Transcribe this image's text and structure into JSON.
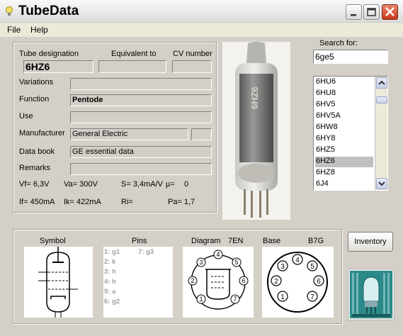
{
  "window": {
    "title": "TubeData"
  },
  "menu": [
    {
      "label": "File"
    },
    {
      "label": "Help"
    }
  ],
  "header": {
    "tube_designation_label": "Tube designation",
    "equivalent_label": "Equivalent to",
    "cv_label": "CV number",
    "tube_designation_value": "6HZ6",
    "equivalent_value": "",
    "cv_value": ""
  },
  "fields": {
    "variations_label": "Variations",
    "variations_value": "",
    "function_label": "Function",
    "function_value": "Pentode",
    "use_label": "Use",
    "use_value": "",
    "manufacturer_label": "Manufacturer",
    "manufacturer_value": "General Electric",
    "manufacturer_extra": "",
    "databook_label": "Data book",
    "databook_value": "GE essential data",
    "remarks_label": "Remarks",
    "remarks_value": ""
  },
  "params": {
    "vf": "Vf= 6,3V",
    "va": "Va= 300V",
    "s": "S= 3,4mA/V",
    "mu": "µ=",
    "mu_value": "0",
    "if": "If= 450mA",
    "ik": "Ik= 422mA",
    "ri": "Ri=",
    "pa": "Pa= 1,7"
  },
  "search": {
    "label": "Search for:",
    "value": "6ge5",
    "results": [
      "6HU6",
      "6HU8",
      "6HV5",
      "6HV5A",
      "6HW8",
      "6HY8",
      "6HZ5",
      "6HZ6",
      "6HZ8",
      "6J4"
    ],
    "selected_index": 7
  },
  "bottom": {
    "symbol_label": "Symbol",
    "pins_label": "Pins",
    "diagram_label": "Diagram",
    "diagram_code": "7EN",
    "base_label": "Base",
    "base_code": "B7G",
    "pins_col1": [
      "1: g1",
      "2: k",
      "3: h",
      "4: h",
      "5: a",
      "6: g2"
    ],
    "pins_col2": [
      "7: g3"
    ],
    "diagram_pins": [
      "1",
      "2",
      "3",
      "4",
      "5",
      "6",
      "7"
    ],
    "base_pins": [
      "1",
      "2",
      "3",
      "4",
      "5",
      "6",
      "7"
    ]
  },
  "inventory_button": "Inventory",
  "tube_photo_text": "6HZ6",
  "colors": {
    "close_button": "#c8391c",
    "panel_bg": "#d4d0c8",
    "selection": "#c0c0c0",
    "logo_bg": "#2a8a8a"
  }
}
